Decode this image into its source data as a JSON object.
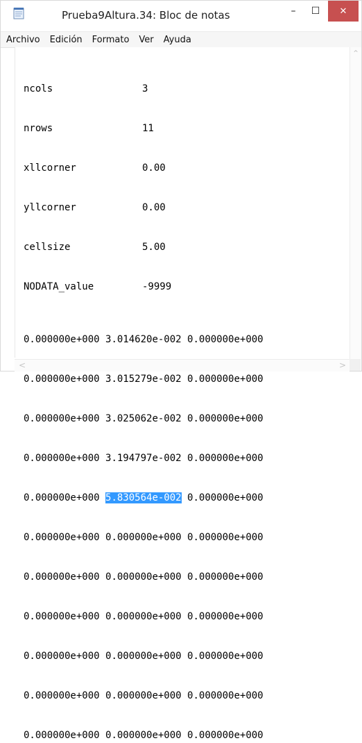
{
  "window": {
    "title": "Prueba9Altura.34: Bloc de notas",
    "controls": {
      "minimize": "–",
      "maximize": "☐",
      "close": "✕"
    },
    "icon": "notepad-icon",
    "colors": {
      "close_button": "#c75050",
      "selection": "#3399ff"
    }
  },
  "menu": [
    {
      "label": "Archivo"
    },
    {
      "label": "Edición"
    },
    {
      "label": "Formato"
    },
    {
      "label": "Ver"
    },
    {
      "label": "Ayuda"
    }
  ],
  "editor": {
    "header": [
      {
        "key": "ncols",
        "value": "3"
      },
      {
        "key": "nrows",
        "value": "11"
      },
      {
        "key": "xllcorner",
        "value": "0.00"
      },
      {
        "key": "yllcorner",
        "value": "0.00"
      },
      {
        "key": "cellsize",
        "value": "5.00"
      },
      {
        "key": "NODATA_value",
        "value": "-9999"
      }
    ],
    "rows": [
      [
        "0.000000e+000",
        "3.014620e-002",
        "0.000000e+000"
      ],
      [
        "0.000000e+000",
        "3.015279e-002",
        "0.000000e+000"
      ],
      [
        "0.000000e+000",
        "3.025062e-002",
        "0.000000e+000"
      ],
      [
        "0.000000e+000",
        "3.194797e-002",
        "0.000000e+000"
      ],
      [
        "0.000000e+000",
        "5.830564e-002",
        "0.000000e+000"
      ],
      [
        "0.000000e+000",
        "0.000000e+000",
        "0.000000e+000"
      ],
      [
        "0.000000e+000",
        "0.000000e+000",
        "0.000000e+000"
      ],
      [
        "0.000000e+000",
        "0.000000e+000",
        "0.000000e+000"
      ],
      [
        "0.000000e+000",
        "0.000000e+000",
        "0.000000e+000"
      ],
      [
        "0.000000e+000",
        "0.000000e+000",
        "0.000000e+000"
      ],
      [
        "0.000000e+000",
        "0.000000e+000",
        "0.000000e+000"
      ]
    ],
    "selected_text": "5.830564e-002"
  },
  "scrollbar": {
    "up": "⌃",
    "left": "<",
    "right": ">"
  }
}
